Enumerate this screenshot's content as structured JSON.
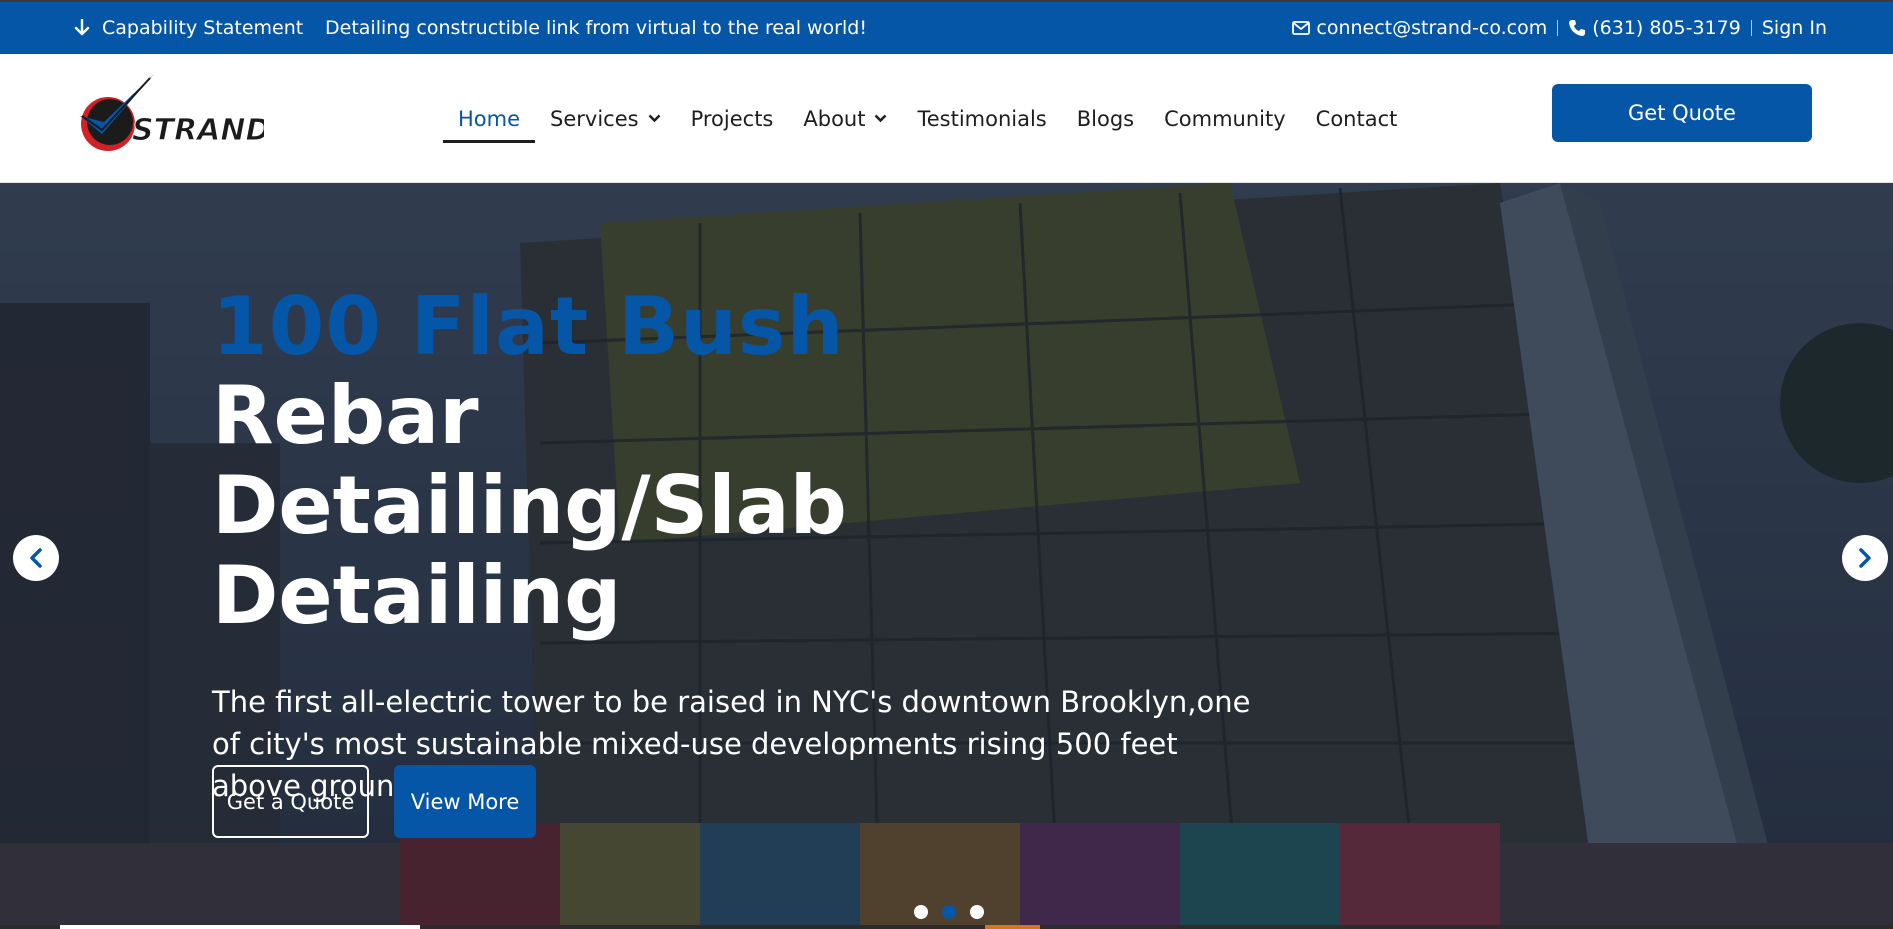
{
  "topbar": {
    "capability_label": "Capability Statement",
    "tagline": "Detailing constructible link from virtual to the real world!",
    "email": "connect@strand-co.com",
    "phone": "(631) 805-3179",
    "signin_label": "Sign In"
  },
  "header": {
    "logo_text": "STRAND",
    "nav": [
      {
        "label": "Home",
        "active": true,
        "dropdown": false
      },
      {
        "label": "Services",
        "active": false,
        "dropdown": true
      },
      {
        "label": "Projects",
        "active": false,
        "dropdown": false
      },
      {
        "label": "About",
        "active": false,
        "dropdown": true
      },
      {
        "label": "Testimonials",
        "active": false,
        "dropdown": false
      },
      {
        "label": "Blogs",
        "active": false,
        "dropdown": false
      },
      {
        "label": "Community",
        "active": false,
        "dropdown": false
      },
      {
        "label": "Contact",
        "active": false,
        "dropdown": false
      }
    ],
    "quote_button": "Get Quote"
  },
  "hero": {
    "kicker": "100 Flat Bush",
    "title": "Rebar Detailing/Slab Detailing",
    "description": "The first all-electric tower to be raised in NYC's downtown Brooklyn,one of city's most sustainable mixed-use developments rising 500 feet above ground.",
    "buttons": {
      "quote": "Get a Quote",
      "more": "View More"
    },
    "slides": {
      "count": 3,
      "active_index": 1
    }
  },
  "colors": {
    "brand_blue": "#0656a8",
    "text_dark": "#1e1e1e",
    "white": "#ffffff"
  },
  "icons": {
    "capability": "download-arrow-icon",
    "email": "envelope-icon",
    "phone": "phone-icon",
    "prev": "chevron-left-icon",
    "next": "chevron-right-icon"
  }
}
